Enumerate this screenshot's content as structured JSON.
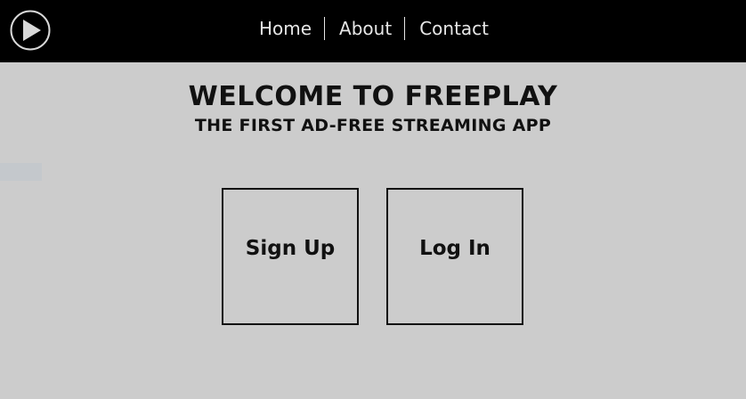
{
  "header": {
    "logo_icon": "play-button-icon",
    "nav": [
      {
        "label": "Home"
      },
      {
        "label": "About"
      },
      {
        "label": "Contact"
      }
    ]
  },
  "main": {
    "title": "WELCOME TO FREEPLAY",
    "subtitle": "THE FIRST AD-FREE STREAMING APP",
    "signup_label": "Sign Up",
    "login_label": "Log In"
  },
  "colors": {
    "header_bg": "#000000",
    "page_bg": "#cccccc",
    "text": "#111111"
  }
}
